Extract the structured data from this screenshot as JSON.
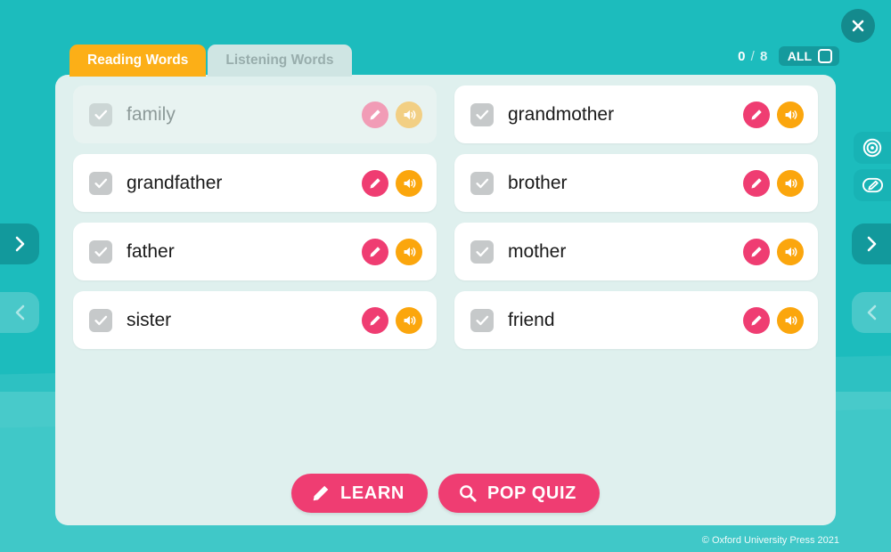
{
  "window": {
    "close_label": "×",
    "copyright": "© Oxford University Press 2021"
  },
  "colors": {
    "background_teal": "#1cbcbd",
    "panel_mint": "#dff0ee",
    "tab_active_orange": "#fcaf17",
    "accent_pink": "#ef3d72",
    "accent_orange": "#fba60d",
    "dark_teal": "#12999c"
  },
  "tabs": [
    {
      "label": "Reading Words",
      "state": "active"
    },
    {
      "label": "Listening Words",
      "state": "inactive"
    }
  ],
  "progress": {
    "completed": "0",
    "separator": "/",
    "total": "8",
    "all_label": "ALL",
    "all_checked": false
  },
  "words": [
    {
      "label": "family",
      "checked": true,
      "dimmed": true
    },
    {
      "label": "grandmother",
      "checked": true,
      "dimmed": false
    },
    {
      "label": "grandfather",
      "checked": true,
      "dimmed": false
    },
    {
      "label": "brother",
      "checked": true,
      "dimmed": false
    },
    {
      "label": "father",
      "checked": true,
      "dimmed": false
    },
    {
      "label": "mother",
      "checked": true,
      "dimmed": false
    },
    {
      "label": "sister",
      "checked": true,
      "dimmed": false
    },
    {
      "label": "friend",
      "checked": true,
      "dimmed": false
    }
  ],
  "actions": [
    {
      "label": "LEARN",
      "icon": "pencil-icon"
    },
    {
      "label": "POP QUIZ",
      "icon": "magnifier-icon"
    }
  ],
  "side_nav": {
    "left_next": "›",
    "left_prev": "‹",
    "right_next": "›",
    "right_prev": "‹"
  },
  "tools": [
    {
      "icon": "target-icon"
    },
    {
      "icon": "pencil-outline-icon"
    }
  ]
}
